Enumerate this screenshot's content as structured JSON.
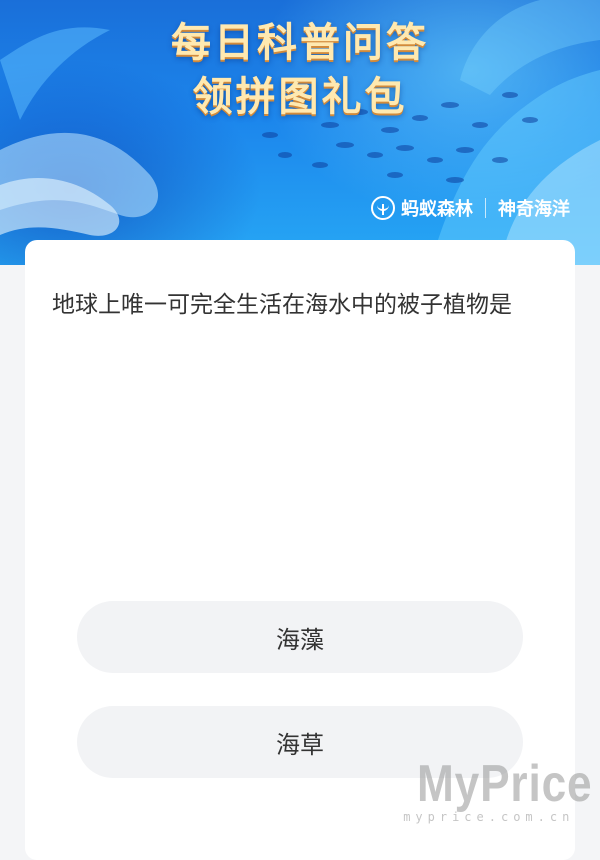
{
  "banner": {
    "title_line1": "每日科普问答",
    "title_line2": "领拼图礼包",
    "brand_name": "蚂蚁森林",
    "brand_tag": "神奇海洋"
  },
  "question": {
    "text": "地球上唯一可完全生活在海水中的被子植物是"
  },
  "options": [
    {
      "label": "海藻"
    },
    {
      "label": "海草"
    }
  ],
  "watermark": {
    "main": "MyPrice",
    "sub": "myprice.com.cn"
  },
  "colors": {
    "banner_top": "#1a6fd9",
    "banner_bottom": "#27a8f5",
    "title_text": "#ffe9b0",
    "option_bg": "#f2f3f5",
    "page_bg": "#f4f5f7"
  }
}
